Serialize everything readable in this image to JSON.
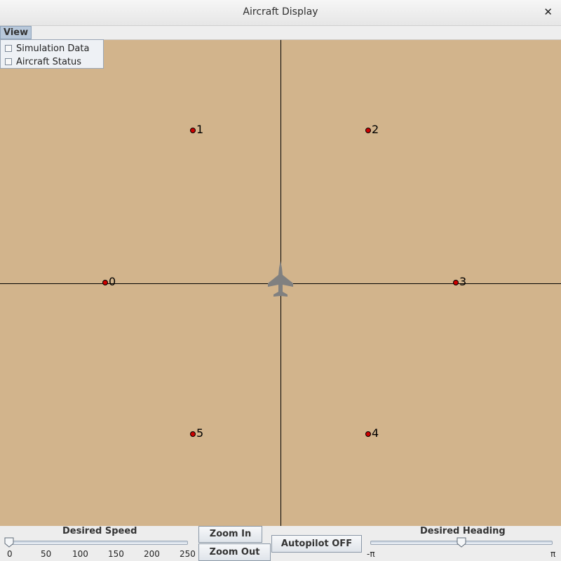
{
  "window": {
    "title": "Aircraft Display",
    "close_glyph": "✕"
  },
  "menu": {
    "view_label": "View",
    "items": [
      {
        "label": "Simulation Data",
        "checked": false
      },
      {
        "label": "Aircraft Status",
        "checked": false
      }
    ]
  },
  "map": {
    "background_color": "#d2b48c",
    "waypoint_color": "#cc0000",
    "aircraft_color": "#808080",
    "waypoints": [
      {
        "label": "0"
      },
      {
        "label": "1"
      },
      {
        "label": "2"
      },
      {
        "label": "3"
      },
      {
        "label": "4"
      },
      {
        "label": "5"
      }
    ]
  },
  "controls": {
    "speed": {
      "label": "Desired Speed",
      "ticks": [
        "0",
        "50",
        "100",
        "150",
        "200",
        "250"
      ],
      "min": 0,
      "max": 250,
      "value": 0
    },
    "zoom_in_label": "Zoom In",
    "zoom_out_label": "Zoom Out",
    "autopilot_label": "Autopilot OFF",
    "heading": {
      "label": "Desired Heading",
      "min_label": "-π",
      "max_label": "π",
      "value_fraction": 0.5
    }
  }
}
